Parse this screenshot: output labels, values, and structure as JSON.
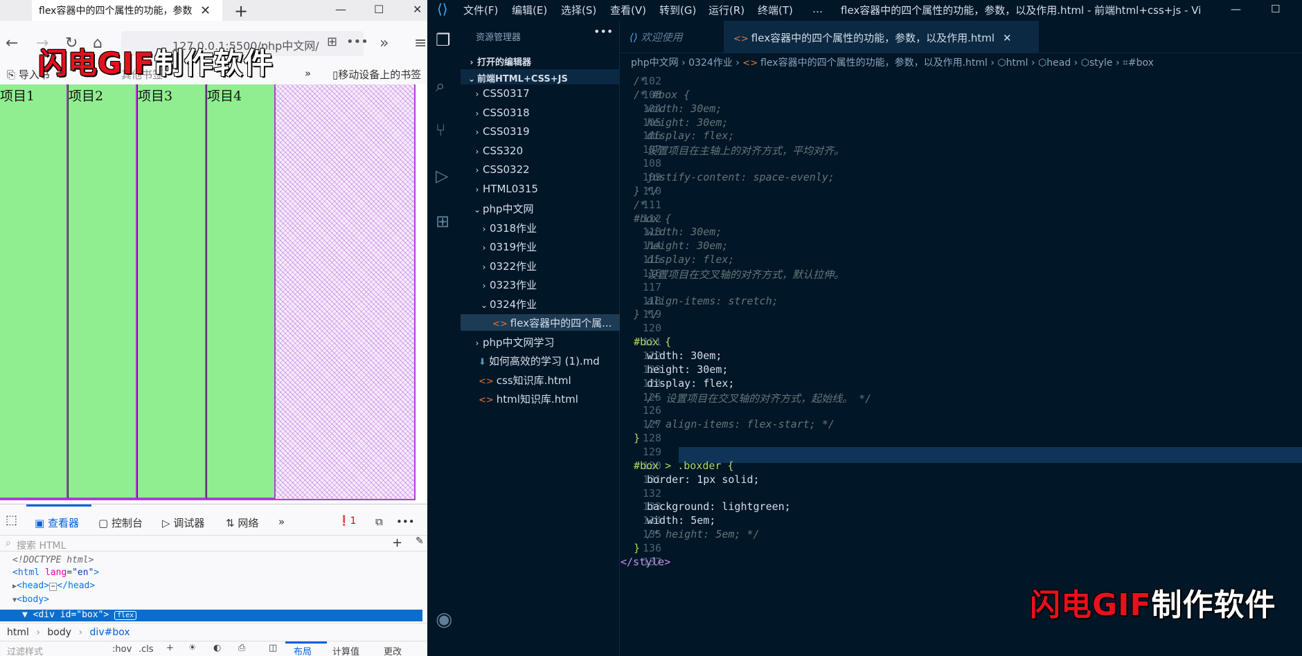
{
  "browser": {
    "tab_title": "flex容器中的四个属性的功能，参数",
    "url": "127.0.0.1:5500/php中文网/",
    "bookmarks": [
      "导入书",
      "其他书签",
      "移动设备上的书签"
    ],
    "flex_items": [
      "项目1",
      "项目2",
      "项目3",
      "项目4"
    ],
    "devtools": {
      "tabs": [
        "查看器",
        "控制台",
        "调试器",
        "网络"
      ],
      "error_count": "1",
      "search_placeholder": "搜索 HTML",
      "dom": {
        "doctype": "<!DOCTYPE html>",
        "html_open": "<html",
        "lang_attr": "lang",
        "lang_val": "\"en\"",
        "head": "<head>",
        "head_close": "</head>",
        "body": "<body>",
        "div_open": "<div id=\"box\">",
        "flex_badge": "flex"
      },
      "breadcrumbs": [
        "html",
        "body",
        "div#box"
      ],
      "bottom_bar": {
        "filter_placeholder": "过滤样式",
        "hov": ":hov",
        "cls": ".cls",
        "tabs": [
          "布局",
          "计算值",
          "更改"
        ]
      }
    }
  },
  "watermark": {
    "red": "闪电GIF",
    "white": "制作软件"
  },
  "vscode": {
    "menus": [
      "文件(F)",
      "编辑(E)",
      "选择(S)",
      "查看(V)",
      "转到(G)",
      "运行(R)",
      "终端(T)",
      "…"
    ],
    "window_title": "flex容器中的四个属性的功能，参数，以及作用.html - 前端html+css+js - Visual ...",
    "sidebar": {
      "title": "资源管理器",
      "open_editors": "打开的编辑器",
      "workspace": "前端HTML+CSS+JS",
      "tree": [
        {
          "label": "CSS0317",
          "depth": 1,
          "kind": "folder"
        },
        {
          "label": "CSS0318",
          "depth": 1,
          "kind": "folder"
        },
        {
          "label": "CSS0319",
          "depth": 1,
          "kind": "folder"
        },
        {
          "label": "CSS320",
          "depth": 1,
          "kind": "folder"
        },
        {
          "label": "CSS0322",
          "depth": 1,
          "kind": "folder"
        },
        {
          "label": "HTML0315",
          "depth": 1,
          "kind": "folder"
        },
        {
          "label": "php中文网",
          "depth": 1,
          "kind": "folder-open"
        },
        {
          "label": "0318作业",
          "depth": 2,
          "kind": "folder"
        },
        {
          "label": "0319作业",
          "depth": 2,
          "kind": "folder"
        },
        {
          "label": "0322作业",
          "depth": 2,
          "kind": "folder"
        },
        {
          "label": "0323作业",
          "depth": 2,
          "kind": "folder"
        },
        {
          "label": "0324作业",
          "depth": 2,
          "kind": "folder-open"
        },
        {
          "label": "flex容器中的四个属...",
          "depth": 3,
          "kind": "html",
          "active": true
        },
        {
          "label": "php中文网学习",
          "depth": 1,
          "kind": "folder"
        },
        {
          "label": "如何高效的学习 (1).md",
          "depth": 1,
          "kind": "md"
        },
        {
          "label": "css知识库.html",
          "depth": 1,
          "kind": "html"
        },
        {
          "label": "html知识库.html",
          "depth": 1,
          "kind": "html"
        }
      ]
    },
    "tabs": [
      "欢迎使用",
      "flex容器中的四个属性的功能，参数，以及作用.html"
    ],
    "breadcrumb": [
      "php中文网",
      "0324作业",
      "flex容器中的四个属性的功能，参数，以及作用.html",
      "html",
      "head",
      "style",
      "#box"
    ],
    "code_lines": [
      {
        "n": "102",
        "t": "/*",
        "c": "cm",
        "i": 3
      },
      {
        "n": "103",
        "t": "/* #box {",
        "c": "cm",
        "i": 3
      },
      {
        "n": "104",
        "t": "width: 30em;",
        "c": "cm",
        "i": 4
      },
      {
        "n": "105",
        "t": "height: 30em;",
        "c": "cm",
        "i": 4
      },
      {
        "n": "106",
        "t": "display: flex;",
        "c": "cm",
        "i": 4
      },
      {
        "n": "107",
        "t": "设置项目在主轴上的对齐方式，平均对齐。",
        "c": "cm",
        "i": 4
      },
      {
        "n": "108",
        "t": "",
        "c": "cm",
        "i": 4
      },
      {
        "n": "109",
        "t": "justify-content: space-evenly;",
        "c": "cm",
        "i": 4
      },
      {
        "n": "110",
        "t": "} */",
        "c": "cm",
        "i": 3
      },
      {
        "n": "111",
        "t": "/*",
        "c": "cm",
        "i": 3
      },
      {
        "n": "112",
        "t": "#box {",
        "c": "cm",
        "i": 3
      },
      {
        "n": "113",
        "t": "width: 30em;",
        "c": "cm",
        "i": 4
      },
      {
        "n": "114",
        "t": "height: 30em;",
        "c": "cm",
        "i": 4
      },
      {
        "n": "115",
        "t": "display: flex;",
        "c": "cm",
        "i": 4
      },
      {
        "n": "116",
        "t": "设置项目在交叉轴的对齐方式，默认拉伸。",
        "c": "cm",
        "i": 4
      },
      {
        "n": "117",
        "t": "",
        "c": "cm",
        "i": 4
      },
      {
        "n": "118",
        "t": "align-items: stretch;",
        "c": "cm",
        "i": 4
      },
      {
        "n": "119",
        "t": "} */",
        "c": "cm",
        "i": 3
      },
      {
        "n": "120",
        "t": "",
        "c": "cm",
        "i": 3
      },
      {
        "n": "121",
        "t": "#box {",
        "c": "sel",
        "i": 3
      },
      {
        "n": "122",
        "t": "width: 30em;",
        "c": "prop",
        "i": 4
      },
      {
        "n": "123",
        "t": "height: 30em;",
        "c": "prop",
        "i": 4
      },
      {
        "n": "124",
        "t": "display: flex;",
        "c": "prop",
        "i": 4
      },
      {
        "n": "125",
        "t": "/* 设置项目在交叉轴的对齐方式，起始线。 */",
        "c": "cm",
        "i": 4
      },
      {
        "n": "126",
        "t": "",
        "c": "cm",
        "i": 4
      },
      {
        "n": "127",
        "t": "/* align-items: flex-start; */",
        "c": "cm",
        "i": 4
      },
      {
        "n": "128",
        "t": "}",
        "c": "sel",
        "i": 3
      },
      {
        "n": "129",
        "t": "",
        "c": "cm",
        "i": 3
      },
      {
        "n": "130",
        "t": "#box > .boxder {",
        "c": "sel",
        "i": 3
      },
      {
        "n": "131",
        "t": "border: 1px solid;",
        "c": "prop",
        "i": 4
      },
      {
        "n": "132",
        "t": "",
        "c": "cm",
        "i": 4
      },
      {
        "n": "133",
        "t": "background: lightgreen;",
        "c": "prop",
        "i": 4
      },
      {
        "n": "134",
        "t": "width: 5em;",
        "c": "prop",
        "i": 4
      },
      {
        "n": "135",
        "t": "/* height: 5em; */",
        "c": "cm",
        "i": 4
      },
      {
        "n": "136",
        "t": "}",
        "c": "sel",
        "i": 3
      },
      {
        "n": "137",
        "t": "</style>",
        "c": "kw",
        "i": 2
      }
    ]
  }
}
